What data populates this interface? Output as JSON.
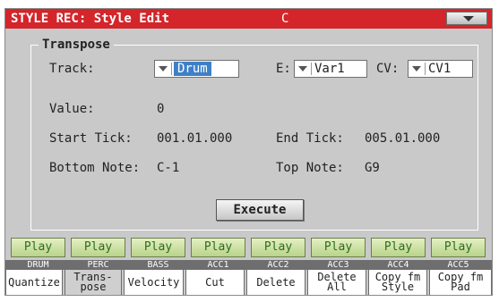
{
  "title_bar": {
    "title": "STYLE REC: Style Edit",
    "song": "C",
    "menu_icon": "menu-arrow-icon"
  },
  "transpose": {
    "group_title": "Transpose",
    "track_label": "Track:",
    "track_value": "Drum",
    "e_label": "E:",
    "e_value": "Var1",
    "cv_label": "CV:",
    "cv_value": "CV1",
    "value_label": "Value:",
    "value": "0",
    "start_tick_label": "Start Tick:",
    "start_tick": "001.01.000",
    "end_tick_label": "End Tick:",
    "end_tick": "005.01.000",
    "bottom_note_label": "Bottom Note:",
    "bottom_note": "C-1",
    "top_note_label": "Top Note:",
    "top_note": "G9",
    "execute_label": "Execute"
  },
  "tracks": [
    {
      "play": "Play",
      "name": "DRUM"
    },
    {
      "play": "Play",
      "name": "PERC"
    },
    {
      "play": "Play",
      "name": "BASS"
    },
    {
      "play": "Play",
      "name": "ACC1"
    },
    {
      "play": "Play",
      "name": "ACC2"
    },
    {
      "play": "Play",
      "name": "ACC3"
    },
    {
      "play": "Play",
      "name": "ACC4"
    },
    {
      "play": "Play",
      "name": "ACC5"
    }
  ],
  "tabs": [
    {
      "label": "Quantize"
    },
    {
      "label": "Trans-\npose"
    },
    {
      "label": "Velocity"
    },
    {
      "label": "Cut"
    },
    {
      "label": "Delete"
    },
    {
      "label": "Delete\nAll"
    },
    {
      "label": "Copy fm\nStyle"
    },
    {
      "label": "Copy fm\nPad"
    }
  ],
  "colors": {
    "title_bar": "#d3252a",
    "selection": "#3e80c8",
    "play_text": "#2f6d1d"
  }
}
